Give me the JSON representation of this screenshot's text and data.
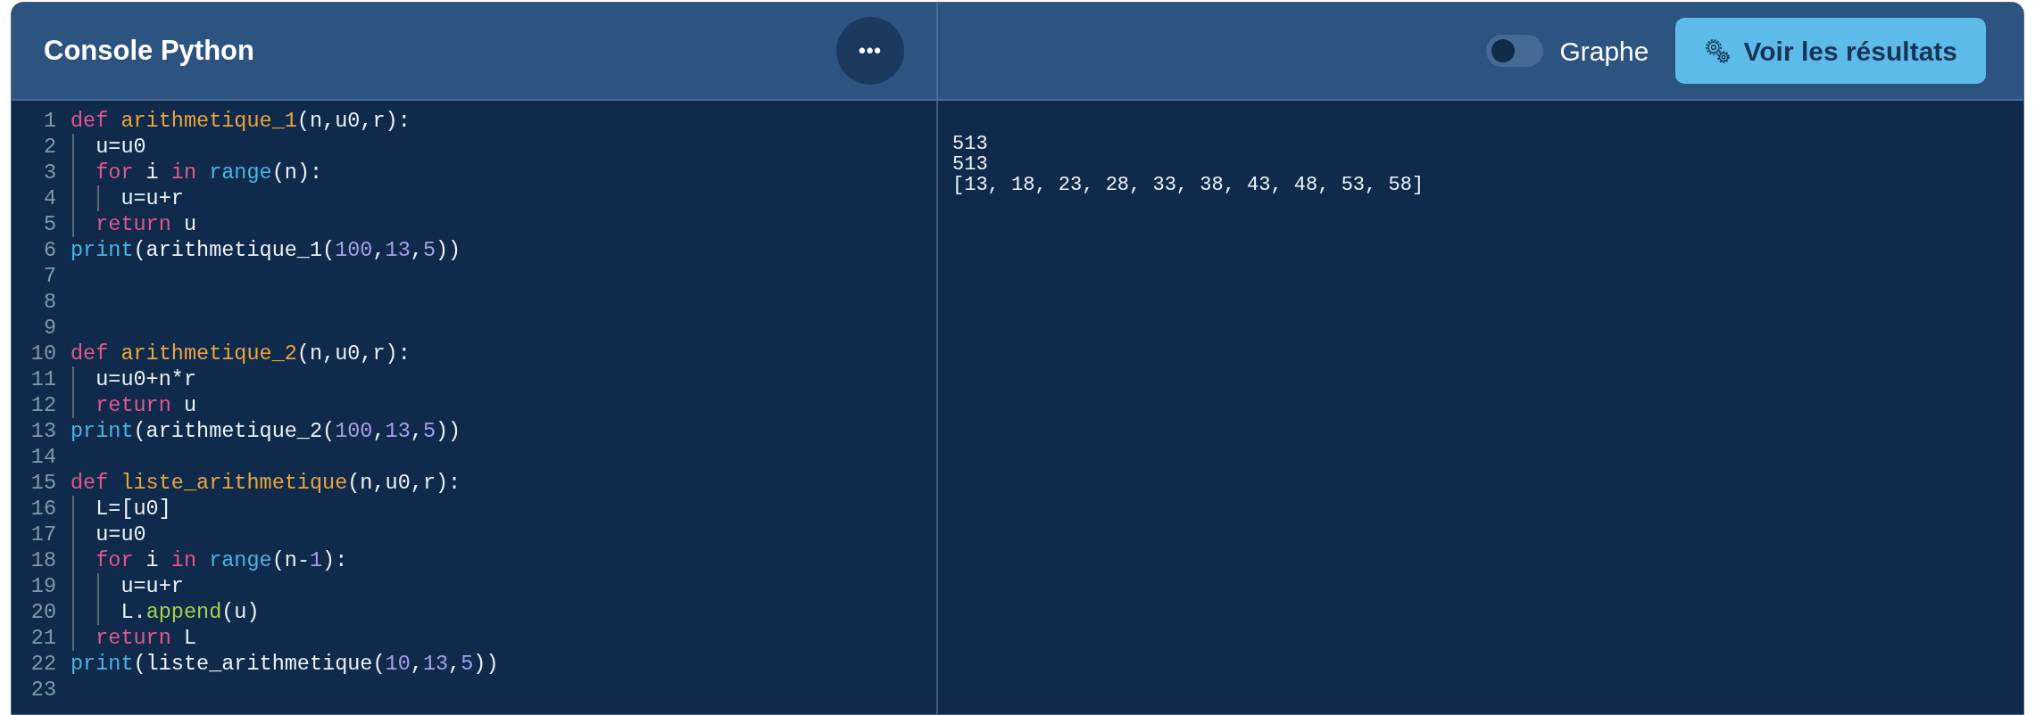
{
  "header": {
    "title": "Console Python",
    "menu_button": "•••",
    "toggle": {
      "label": "Graphe",
      "on": false
    },
    "run_button": "Voir les résultats"
  },
  "editor": {
    "lines": [
      {
        "number": "1",
        "tokens": [
          {
            "kind": "keyword",
            "text": "def"
          },
          {
            "kind": "function",
            "text": " arithmetique_1"
          },
          {
            "kind": "plain",
            "text": "(n,u0,r):"
          }
        ]
      },
      {
        "number": "2",
        "tokens": [
          {
            "kind": "plain",
            "text": "  u=u0"
          }
        ]
      },
      {
        "number": "3",
        "tokens": [
          {
            "kind": "keyword",
            "text": "  for"
          },
          {
            "kind": "plain",
            "text": " i"
          },
          {
            "kind": "keyword",
            "text": " in"
          },
          {
            "kind": "builtin",
            "text": " range"
          },
          {
            "kind": "plain",
            "text": "(n):"
          }
        ]
      },
      {
        "number": "4",
        "tokens": [
          {
            "kind": "plain",
            "text": "    u=u+r"
          }
        ]
      },
      {
        "number": "5",
        "tokens": [
          {
            "kind": "keyword",
            "text": "  return"
          },
          {
            "kind": "plain",
            "text": " u"
          }
        ]
      },
      {
        "number": "6",
        "tokens": [
          {
            "kind": "builtin",
            "text": "print"
          },
          {
            "kind": "plain",
            "text": "(arithmetique_1("
          },
          {
            "kind": "number",
            "text": "100"
          },
          {
            "kind": "plain",
            "text": ","
          },
          {
            "kind": "number",
            "text": "13"
          },
          {
            "kind": "plain",
            "text": ","
          },
          {
            "kind": "number",
            "text": "5"
          },
          {
            "kind": "plain",
            "text": "))"
          }
        ]
      },
      {
        "number": "7"
      },
      {
        "number": "8"
      },
      {
        "number": "9"
      },
      {
        "number": "10",
        "tokens": [
          {
            "kind": "keyword",
            "text": "def"
          },
          {
            "kind": "function",
            "text": " arithmetique_2"
          },
          {
            "kind": "plain",
            "text": "(n,u0,r):"
          }
        ]
      },
      {
        "number": "11",
        "tokens": [
          {
            "kind": "plain",
            "text": "  u=u0+n*r"
          }
        ]
      },
      {
        "number": "12",
        "tokens": [
          {
            "kind": "keyword",
            "text": "  return"
          },
          {
            "kind": "plain",
            "text": " u"
          }
        ]
      },
      {
        "number": "13",
        "tokens": [
          {
            "kind": "builtin",
            "text": "print"
          },
          {
            "kind": "plain",
            "text": "(arithmetique_2("
          },
          {
            "kind": "number",
            "text": "100"
          },
          {
            "kind": "plain",
            "text": ","
          },
          {
            "kind": "number",
            "text": "13"
          },
          {
            "kind": "plain",
            "text": ","
          },
          {
            "kind": "number",
            "text": "5"
          },
          {
            "kind": "plain",
            "text": "))"
          }
        ]
      },
      {
        "number": "14"
      },
      {
        "number": "15",
        "tokens": [
          {
            "kind": "keyword",
            "text": "def"
          },
          {
            "kind": "function",
            "text": " liste_arithmetique"
          },
          {
            "kind": "plain",
            "text": "(n,u0,r):"
          }
        ]
      },
      {
        "number": "16",
        "tokens": [
          {
            "kind": "plain",
            "text": "  L=[u0]"
          }
        ]
      },
      {
        "number": "17",
        "tokens": [
          {
            "kind": "plain",
            "text": "  u=u0"
          }
        ]
      },
      {
        "number": "18",
        "tokens": [
          {
            "kind": "keyword",
            "text": "  for"
          },
          {
            "kind": "plain",
            "text": " i"
          },
          {
            "kind": "keyword",
            "text": " in"
          },
          {
            "kind": "builtin",
            "text": " range"
          },
          {
            "kind": "plain",
            "text": "(n-"
          },
          {
            "kind": "number",
            "text": "1"
          },
          {
            "kind": "plain",
            "text": "):"
          }
        ]
      },
      {
        "number": "19",
        "tokens": [
          {
            "kind": "plain",
            "text": "    u=u+r"
          }
        ]
      },
      {
        "number": "20",
        "tokens": [
          {
            "kind": "plain",
            "text": "    L."
          },
          {
            "kind": "method",
            "text": "append"
          },
          {
            "kind": "plain",
            "text": "(u)"
          }
        ]
      },
      {
        "number": "21",
        "tokens": [
          {
            "kind": "keyword",
            "text": "  return"
          },
          {
            "kind": "plain",
            "text": " L"
          }
        ]
      },
      {
        "number": "22",
        "tokens": [
          {
            "kind": "builtin",
            "text": "print"
          },
          {
            "kind": "plain",
            "text": "(liste_arithmetique("
          },
          {
            "kind": "number",
            "text": "10"
          },
          {
            "kind": "plain",
            "text": ","
          },
          {
            "kind": "number",
            "text": "13"
          },
          {
            "kind": "plain",
            "text": ","
          },
          {
            "kind": "number",
            "text": "5"
          },
          {
            "kind": "plain",
            "text": "))"
          }
        ]
      },
      {
        "number": "23"
      }
    ]
  },
  "output": {
    "lines": [
      "513",
      "513",
      "[13, 18, 23, 28, 33, 38, 43, 48, 53, 58]"
    ]
  }
}
